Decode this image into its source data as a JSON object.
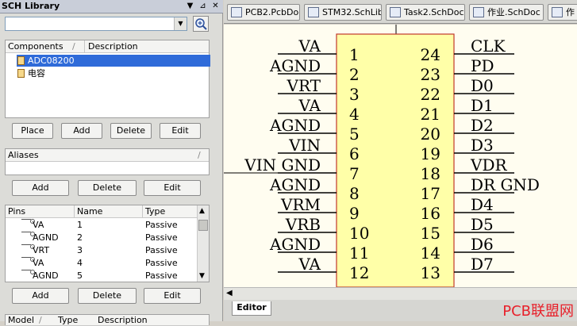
{
  "panel": {
    "title": "SCH Library",
    "title_buttons": [
      "▼",
      "⊿",
      "✕"
    ],
    "filter_value": "",
    "components": {
      "headers": [
        "Components",
        "/",
        "Description"
      ],
      "items": [
        {
          "name": "ADC08200",
          "selected": true
        },
        {
          "name": "电容",
          "selected": false
        }
      ],
      "buttons": [
        "Place",
        "Add",
        "Delete",
        "Edit"
      ]
    },
    "aliases": {
      "headers": [
        "Aliases",
        "/"
      ],
      "buttons": [
        "Add",
        "Delete",
        "Edit"
      ]
    },
    "pins": {
      "headers": [
        "Pins",
        "Name",
        "Type"
      ],
      "rows": [
        {
          "pin": "VA",
          "name": "1",
          "type": "Passive"
        },
        {
          "pin": "AGND",
          "name": "2",
          "type": "Passive"
        },
        {
          "pin": "VRT",
          "name": "3",
          "type": "Passive"
        },
        {
          "pin": "VA",
          "name": "4",
          "type": "Passive"
        },
        {
          "pin": "AGND",
          "name": "5",
          "type": "Passive"
        }
      ],
      "buttons": [
        "Add",
        "Delete",
        "Edit"
      ]
    },
    "model": {
      "headers": [
        "Model",
        "/",
        "Type",
        "Description"
      ]
    }
  },
  "tabs": [
    {
      "label": "PCB2.PcbDoc"
    },
    {
      "label": "STM32.SchLib"
    },
    {
      "label": "Task2.SchDoc *"
    },
    {
      "label": "作业.SchDoc"
    },
    {
      "label": "作"
    }
  ],
  "schematic": {
    "left_pins": [
      {
        "label": "VA",
        "num": "1"
      },
      {
        "label": "AGND",
        "num": "2"
      },
      {
        "label": "VRT",
        "num": "3"
      },
      {
        "label": "VA",
        "num": "4"
      },
      {
        "label": "AGND",
        "num": "5"
      },
      {
        "label": "VIN",
        "num": "6"
      },
      {
        "label": "VIN GND",
        "num": "7"
      },
      {
        "label": "AGND",
        "num": "8"
      },
      {
        "label": "VRM",
        "num": "9"
      },
      {
        "label": "VRB",
        "num": "10"
      },
      {
        "label": "AGND",
        "num": "11"
      },
      {
        "label": "VA",
        "num": "12"
      }
    ],
    "right_pins": [
      {
        "label": "CLK",
        "num": "24"
      },
      {
        "label": "PD",
        "num": "23"
      },
      {
        "label": "D0",
        "num": "22"
      },
      {
        "label": "D1",
        "num": "21"
      },
      {
        "label": "D2",
        "num": "20"
      },
      {
        "label": "D3",
        "num": "19"
      },
      {
        "label": "VDR",
        "num": "18"
      },
      {
        "label": "DR GND",
        "num": "17"
      },
      {
        "label": "D4",
        "num": "16"
      },
      {
        "label": "D5",
        "num": "15"
      },
      {
        "label": "D6",
        "num": "14"
      },
      {
        "label": "D7",
        "num": "13"
      }
    ],
    "body_color": "#ffffa8",
    "body_border": "#c0392b"
  },
  "editor_tab": "Editor",
  "watermark": "PCB联盟网",
  "colors": {
    "selection": "#2f6bd9",
    "watermark": "#e8202a"
  }
}
